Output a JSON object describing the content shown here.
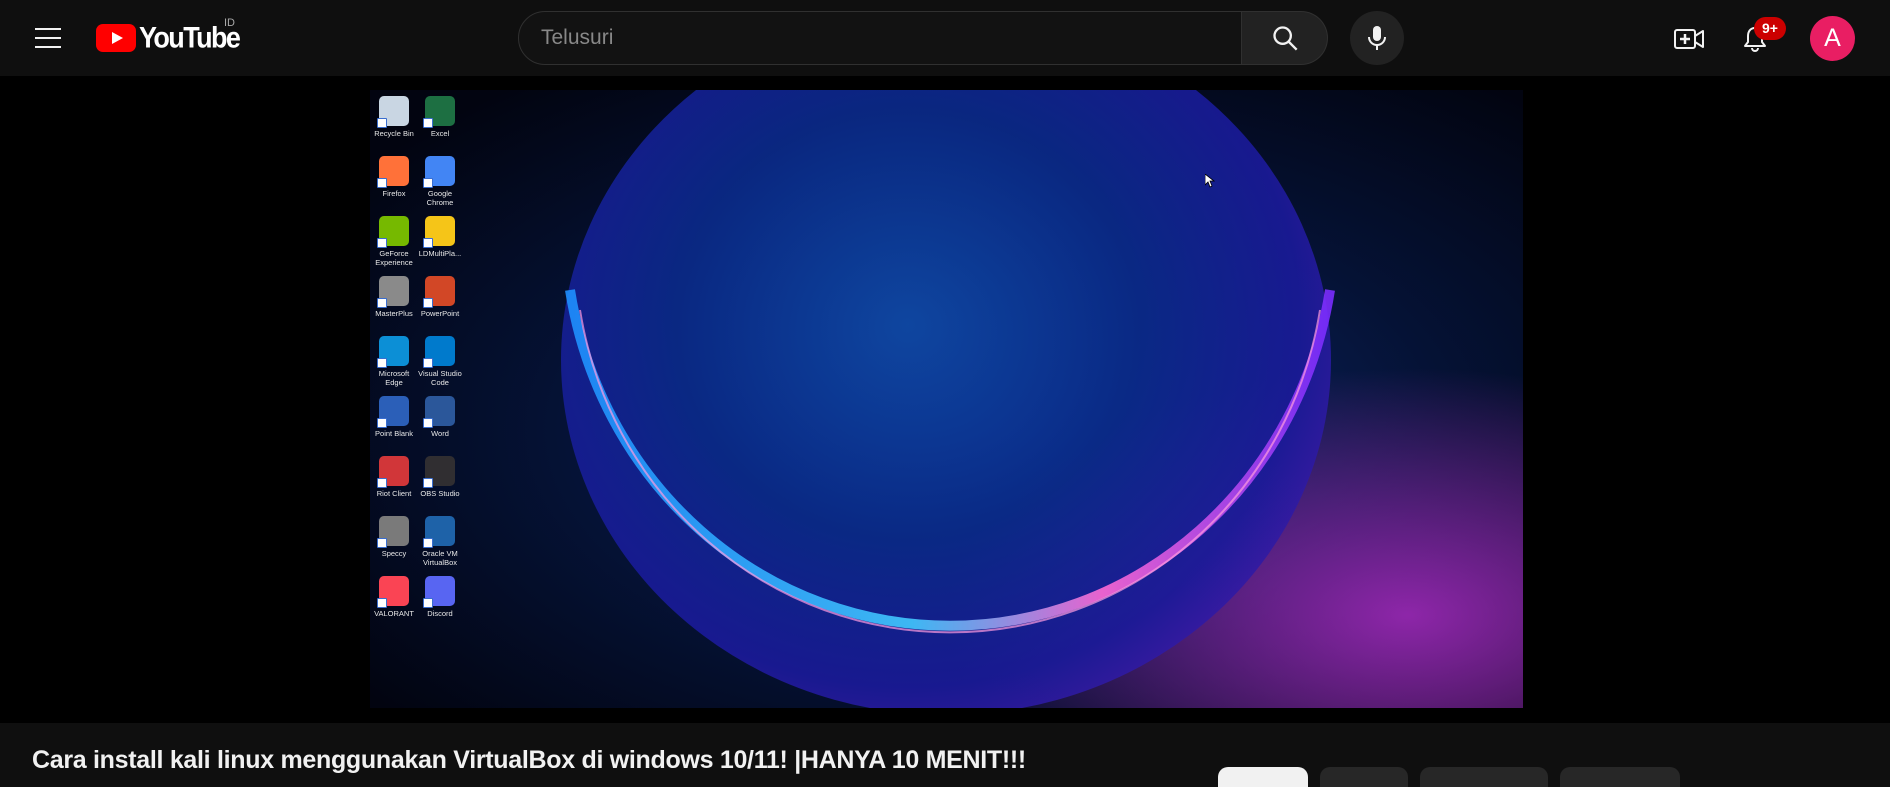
{
  "masthead": {
    "logo_text": "YouTube",
    "country_code": "ID",
    "search_placeholder": "Telusuri",
    "notification_badge": "9+",
    "avatar_letter": "A"
  },
  "desktop_icons": [
    {
      "label": "Recycle Bin",
      "color": "#c9d6e3"
    },
    {
      "label": "Excel",
      "color": "#1d6f42"
    },
    {
      "label": "Firefox",
      "color": "#ff7139"
    },
    {
      "label": "Google Chrome",
      "color": "#4285f4"
    },
    {
      "label": "GeForce Experience",
      "color": "#76b900"
    },
    {
      "label": "LDMultiPla...",
      "color": "#f5c518"
    },
    {
      "label": "MasterPlus",
      "color": "#8a8a8a"
    },
    {
      "label": "PowerPoint",
      "color": "#d24726"
    },
    {
      "label": "Microsoft Edge",
      "color": "#0c8fd6"
    },
    {
      "label": "Visual Studio Code",
      "color": "#007acc"
    },
    {
      "label": "Point Blank",
      "color": "#2b5fb8"
    },
    {
      "label": "Word",
      "color": "#2b579a"
    },
    {
      "label": "Riot Client",
      "color": "#d13639"
    },
    {
      "label": "OBS Studio",
      "color": "#302e31"
    },
    {
      "label": "Speccy",
      "color": "#7a7a7a"
    },
    {
      "label": "Oracle VM VirtualBox",
      "color": "#1e62a8"
    },
    {
      "label": "VALORANT",
      "color": "#fa4454"
    },
    {
      "label": "Discord",
      "color": "#5865f2"
    }
  ],
  "video": {
    "title": "Cara install kali linux menggunakan VirtualBox di windows 10/11! |HANYA 10 MENIT!!!"
  },
  "colors": {
    "youtube_red": "#ff0000",
    "background": "#0f0f0f",
    "badge": "#cc0000",
    "avatar": "#e91e63"
  }
}
